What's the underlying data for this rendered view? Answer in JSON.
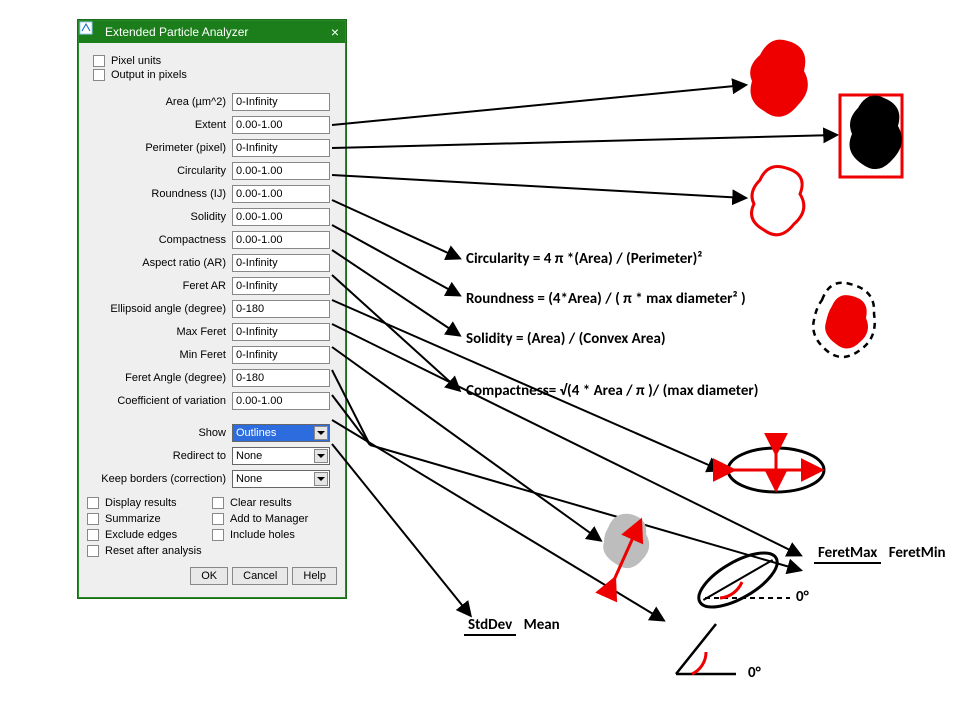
{
  "dialog": {
    "title": "Extended Particle Analyzer",
    "close": "×",
    "top_checks": {
      "pixel_units": "Pixel units",
      "output_in_pixels": "Output in pixels"
    },
    "fields": [
      {
        "label": "Area (µm^2)",
        "value": "0-Infinity"
      },
      {
        "label": "Extent",
        "value": "0.00-1.00"
      },
      {
        "label": "Perimeter (pixel)",
        "value": "0-Infinity"
      },
      {
        "label": "Circularity",
        "value": "0.00-1.00"
      },
      {
        "label": "Roundness (IJ)",
        "value": "0.00-1.00"
      },
      {
        "label": "Solidity",
        "value": "0.00-1.00"
      },
      {
        "label": "Compactness",
        "value": "0.00-1.00"
      },
      {
        "label": "Aspect ratio (AR)",
        "value": "0-Infinity"
      },
      {
        "label": "Feret AR",
        "value": "0-Infinity"
      },
      {
        "label": "Ellipsoid angle (degree)",
        "value": "0-180"
      },
      {
        "label": "Max Feret",
        "value": "0-Infinity"
      },
      {
        "label": "Min Feret",
        "value": "0-Infinity"
      },
      {
        "label": "Feret Angle (degree)",
        "value": "0-180"
      },
      {
        "label": "Coefficient of variation",
        "value": "0.00-1.00"
      }
    ],
    "selects": [
      {
        "label": "Show",
        "value": "Outlines",
        "selected": true
      },
      {
        "label": "Redirect to",
        "value": "None",
        "selected": false
      },
      {
        "label": "Keep borders (correction)",
        "value": "None",
        "selected": false
      }
    ],
    "bottom_checks": {
      "display_results": "Display results",
      "clear_results": "Clear results",
      "summarize": "Summarize",
      "add_to_manager": "Add to Manager",
      "exclude_edges": "Exclude edges",
      "include_holes": "Include holes",
      "reset_after": "Reset after analysis"
    },
    "buttons": {
      "ok": "OK",
      "cancel": "Cancel",
      "help": "Help"
    }
  },
  "annotations": {
    "circularity": "Circularity   =   4 π *(Area) / (Perimeter)²",
    "roundness": "Roundness =   (4*Area) / ( π * max diameter² )",
    "solidity": "Solidity    =   (Area) / (Convex Area)",
    "compactness": "Compactness=   √(4 * Area / π )/ (max diameter)",
    "feret_max": "FeretMax",
    "feret_min": "FeretMin",
    "stddev": "StdDev",
    "mean": "Mean",
    "zero_deg_1": "0°",
    "zero_deg_2": "0°"
  }
}
